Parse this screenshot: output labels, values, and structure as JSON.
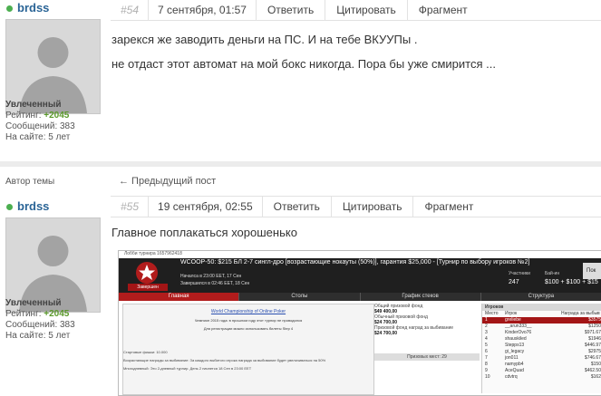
{
  "post1": {
    "username": "brdss",
    "post_number": "#54",
    "date": "7 сентября, 01:57",
    "actions": [
      "Ответить",
      "Цитировать",
      "Фрагмент"
    ],
    "paragraphs": [
      "зарекся же заводить деньги на ПС. И на тебе ВКУУПы .",
      "не отдаст этот автомат на мой бокс никогда. Пора бы уже смирится ..."
    ],
    "rank": "Увлеченный",
    "rating_label": "Рейтинг:",
    "rating_value": "+2045",
    "messages": "Сообщений: 383",
    "on_site": "На сайте: 5 лет"
  },
  "topic_author_label": "Автор темы",
  "prev_post_link": "← Предыдущий пост",
  "post2": {
    "username": "brdss",
    "post_number": "#55",
    "date": "19 сентября, 02:55",
    "actions": [
      "Ответить",
      "Цитировать",
      "Фрагмент"
    ],
    "paragraph": "Главное поплакаться хорошенько",
    "rank": "Увлеченный",
    "rating_label": "Рейтинг:",
    "rating_value": "+2045",
    "messages": "Сообщений: 383",
    "on_site": "На сайте: 5 лет"
  },
  "embed": {
    "lobby_title": "Лобби турнира 1657962418",
    "heading": "WCOOP-50: $215 БЛ 2-7 сингл-дро [возрастающие нокауты (50%)], гарантия $25,000 - [Турнир по выбору игроков №2]",
    "starts": "Началса в 23:00 EET, 17 Сен",
    "ends": "Завершился в 02:46 EET, 18 Сен",
    "registration_btn": "Завершен",
    "players_label": "Участники",
    "players_value": "247",
    "buyin_label": "Бай-ин",
    "buyin_value": "$100 + $100 + $15",
    "reg_button": "Пок",
    "tabs": [
      "Главная",
      "Столы",
      "График стеков",
      "Структура"
    ],
    "wc_link": "World Championship of Online Poker",
    "champion_line": "Чемпион 2015 года: в прошлом году этот турнир не проводился",
    "tickets_line": "Для регистрации можно использовать билеты Step 4",
    "info_rows": [
      "Стартовые фишки: 10.000",
      "Возрастающие награды за выбивание: За каждого выбитого игрока награда за выбивание будет увеличиваться на 50%",
      "Многодневный: Это 2-дневный турнир. День 2 начнется 18 Сен в 23:00 EET"
    ],
    "prize_total_label": "Общий призовой фонд",
    "prize_total": "$49 400,00",
    "regular_prize_label": "Обычный призовой фонд",
    "regular_prize": "$24 700,00",
    "bounty_prize_label": "Призовой фонд наград за выбивание",
    "bounty_prize": "$24 700,00",
    "prize_places": "Призовых мест: 29",
    "players_header": "Игроков",
    "cols": [
      "Место",
      "Игрок",
      "Награда за выбыв"
    ],
    "rows": [
      [
        "1",
        "greliebe",
        "$3575"
      ],
      [
        "2",
        "__arun333__",
        "$1250"
      ],
      [
        "3",
        "KinderOvo76",
        "$971.67"
      ],
      [
        "4",
        "shauskiled",
        "$1946"
      ],
      [
        "5",
        "Stepps13",
        "$446.97"
      ],
      [
        "6",
        "gi_legacy",
        "$2975"
      ],
      [
        "7",
        "jon011",
        "$746.67"
      ],
      [
        "8",
        "namypb4",
        "$150"
      ],
      [
        "9",
        "AceQuad",
        "$462.50"
      ],
      [
        "10",
        "cdvtrq",
        "$162"
      ]
    ]
  }
}
